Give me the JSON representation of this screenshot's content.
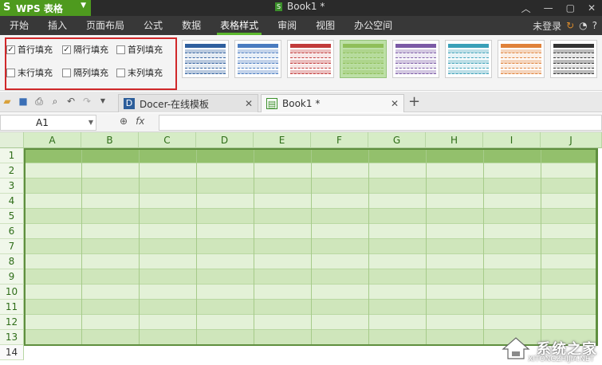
{
  "app": {
    "name": "WPS 表格",
    "doc_title": "Book1 *"
  },
  "menu": {
    "items": [
      "开始",
      "插入",
      "页面布局",
      "公式",
      "数据",
      "表格样式",
      "审阅",
      "视图",
      "办公空间"
    ],
    "active": "表格样式",
    "login": "未登录"
  },
  "ribbon": {
    "options": [
      {
        "label": "首行填充",
        "checked": true
      },
      {
        "label": "隔行填充",
        "checked": true
      },
      {
        "label": "首列填充",
        "checked": false
      },
      {
        "label": "末行填充",
        "checked": false
      },
      {
        "label": "隔列填充",
        "checked": false
      },
      {
        "label": "末列填充",
        "checked": false
      }
    ],
    "style_colors": [
      "#2f5f9e",
      "#4a7cc0",
      "#c23b3b",
      "#8fbf5a",
      "#7b5aa6",
      "#3aa0b8",
      "#e0823a",
      "#333333"
    ],
    "selected_style_index": 3
  },
  "tabs": [
    {
      "label": "Docer-在线模板",
      "icon": "docer-icon"
    },
    {
      "label": "Book1 *",
      "icon": "spreadsheet-icon"
    }
  ],
  "formula": {
    "cell_ref": "A1",
    "fx_label": "fx",
    "value": ""
  },
  "grid": {
    "columns": [
      "A",
      "B",
      "C",
      "D",
      "E",
      "F",
      "G",
      "H",
      "I",
      "J"
    ],
    "rows": [
      "1",
      "2",
      "3",
      "4",
      "5",
      "6",
      "7",
      "8",
      "9",
      "10",
      "11",
      "12",
      "13",
      "14"
    ]
  },
  "watermark": {
    "text": "系统之家",
    "sub": "XITONGZHIJIA.NET"
  }
}
